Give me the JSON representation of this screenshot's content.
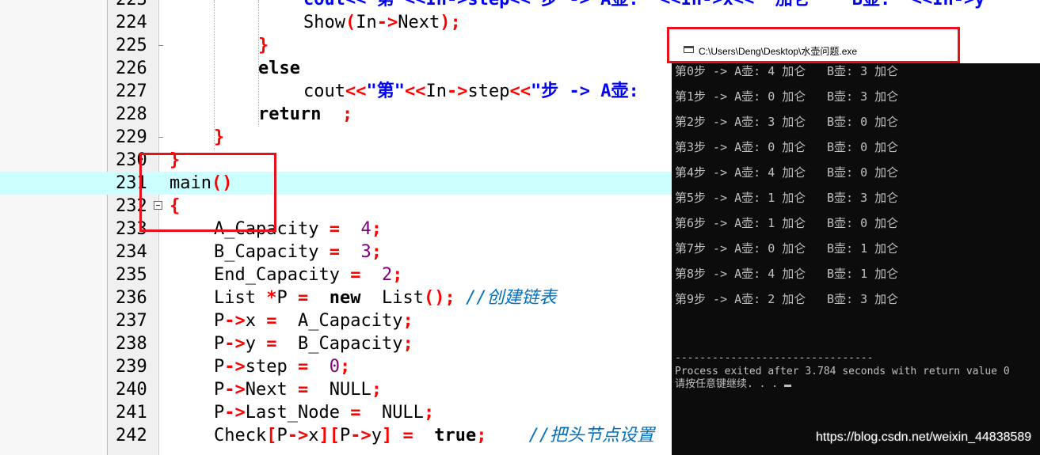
{
  "editor": {
    "lines": [
      {
        "num": "223",
        "tokens": []
      },
      {
        "num": "224",
        "tokens": [
          [
            "",
            "Show"
          ],
          [
            "pr",
            "("
          ],
          [
            "",
            "In"
          ],
          [
            "op",
            "->"
          ],
          [
            "",
            "Next"
          ],
          [
            "pr",
            ")"
          ],
          [
            "op",
            ";"
          ]
        ]
      },
      {
        "num": "225",
        "tokens": [
          [
            "pr",
            "}"
          ]
        ]
      },
      {
        "num": "226",
        "tokens": [
          [
            "kw",
            "else"
          ]
        ]
      },
      {
        "num": "227",
        "tokens": [
          [
            "",
            "cout"
          ],
          [
            "op",
            "<<"
          ],
          [
            "str",
            "\"第\""
          ],
          [
            "op",
            "<<"
          ],
          [
            "",
            "In"
          ],
          [
            "op",
            "->"
          ],
          [
            "",
            "step"
          ],
          [
            "op",
            "<<"
          ],
          [
            "str",
            "\"步 -> A壶: "
          ]
        ]
      },
      {
        "num": "228",
        "tokens": [
          [
            "kw",
            "return"
          ],
          [
            "",
            "  "
          ],
          [
            "op",
            ";"
          ]
        ]
      },
      {
        "num": "229",
        "tokens": [
          [
            "pr",
            "}"
          ]
        ]
      },
      {
        "num": "230",
        "tokens": [
          [
            "pr",
            "}"
          ]
        ]
      },
      {
        "num": "231",
        "tokens": [
          [
            "",
            "main"
          ],
          [
            "pr",
            "()"
          ]
        ]
      },
      {
        "num": "232",
        "tokens": [
          [
            "pr",
            "{"
          ]
        ]
      },
      {
        "num": "233",
        "tokens": [
          [
            "",
            "A_Capacity "
          ],
          [
            "op",
            "="
          ],
          [
            "",
            "  "
          ],
          [
            "num",
            "4"
          ],
          [
            "op",
            ";"
          ]
        ]
      },
      {
        "num": "234",
        "tokens": [
          [
            "",
            "B_Capacity "
          ],
          [
            "op",
            "="
          ],
          [
            "",
            "  "
          ],
          [
            "num",
            "3"
          ],
          [
            "op",
            ";"
          ]
        ]
      },
      {
        "num": "235",
        "tokens": [
          [
            "",
            "End_Capacity "
          ],
          [
            "op",
            "="
          ],
          [
            "",
            "  "
          ],
          [
            "num",
            "2"
          ],
          [
            "op",
            ";"
          ]
        ]
      },
      {
        "num": "236",
        "tokens": [
          [
            "",
            "List "
          ],
          [
            "op",
            "*"
          ],
          [
            "",
            "P "
          ],
          [
            "op",
            "="
          ],
          [
            "",
            "  "
          ],
          [
            "kw",
            "new"
          ],
          [
            "",
            "  List"
          ],
          [
            "pr",
            "()"
          ],
          [
            "op",
            ";"
          ],
          [
            "",
            ""
          ],
          [
            "cm",
            " //创建链表"
          ]
        ]
      },
      {
        "num": "237",
        "tokens": [
          [
            "",
            "P"
          ],
          [
            "op",
            "->"
          ],
          [
            "",
            "x "
          ],
          [
            "op",
            "="
          ],
          [
            "",
            "  A_Capacity"
          ],
          [
            "op",
            ";"
          ]
        ]
      },
      {
        "num": "238",
        "tokens": [
          [
            "",
            "P"
          ],
          [
            "op",
            "->"
          ],
          [
            "",
            "y "
          ],
          [
            "op",
            "="
          ],
          [
            "",
            "  B_Capacity"
          ],
          [
            "op",
            ";"
          ]
        ]
      },
      {
        "num": "239",
        "tokens": [
          [
            "",
            "P"
          ],
          [
            "op",
            "->"
          ],
          [
            "",
            "step "
          ],
          [
            "op",
            "="
          ],
          [
            "",
            "  "
          ],
          [
            "num",
            "0"
          ],
          [
            "op",
            ";"
          ]
        ]
      },
      {
        "num": "240",
        "tokens": [
          [
            "",
            "P"
          ],
          [
            "op",
            "->"
          ],
          [
            "",
            "Next "
          ],
          [
            "op",
            "="
          ],
          [
            "",
            "  NULL"
          ],
          [
            "op",
            ";"
          ]
        ]
      },
      {
        "num": "241",
        "tokens": [
          [
            "",
            "P"
          ],
          [
            "op",
            "->"
          ],
          [
            "",
            "Last_Node "
          ],
          [
            "op",
            "="
          ],
          [
            "",
            "  NULL"
          ],
          [
            "op",
            ";"
          ]
        ]
      },
      {
        "num": "242",
        "tokens": [
          [
            "",
            "Check"
          ],
          [
            "pr",
            "["
          ],
          [
            "",
            "P"
          ],
          [
            "op",
            "->"
          ],
          [
            "",
            "x"
          ],
          [
            "pr",
            "]["
          ],
          [
            "",
            "P"
          ],
          [
            "op",
            "->"
          ],
          [
            "",
            "y"
          ],
          [
            "pr",
            "]"
          ],
          [
            "",
            ""
          ],
          [
            "op",
            " ="
          ],
          [
            "",
            "  "
          ],
          [
            "kw",
            "true"
          ],
          [
            "op",
            ";"
          ],
          [
            "cm",
            "    //把头节点设置"
          ]
        ]
      }
    ],
    "line223_text": "cout<<\"第\"<<In->step<<\"步 -> A壶: \"<<In->x<<\" 加仑    B壶: \"<<In->y"
  },
  "console": {
    "title": "C:\\Users\\Deng\\Desktop\\水壶问题.exe",
    "rows": [
      {
        "a": "第0步 -> A壶: 4 加仑",
        "b": "B壶: 3 加仑"
      },
      {
        "a": "第1步 -> A壶: 0 加仑",
        "b": "B壶: 3 加仑"
      },
      {
        "a": "第2步 -> A壶: 3 加仑",
        "b": "B壶: 0 加仑"
      },
      {
        "a": "第3步 -> A壶: 0 加仑",
        "b": "B壶: 0 加仑"
      },
      {
        "a": "第4步 -> A壶: 4 加仑",
        "b": "B壶: 0 加仑"
      },
      {
        "a": "第5步 -> A壶: 1 加仑",
        "b": "B壶: 3 加仑"
      },
      {
        "a": "第6步 -> A壶: 1 加仑",
        "b": "B壶: 0 加仑"
      },
      {
        "a": "第7步 -> A壶: 0 加仑",
        "b": "B壶: 1 加仑"
      },
      {
        "a": "第8步 -> A壶: 4 加仑",
        "b": "B壶: 1 加仑"
      },
      {
        "a": "第9步 -> A壶: 2 加仑",
        "b": "B壶: 3 加仑"
      }
    ],
    "separator": "--------------------------------",
    "process_exit": "Process exited after 3.784 seconds with return value 0",
    "press_key": "请按任意键继续. . . "
  },
  "watermark": "https://blog.csdn.net/weixin_44838589"
}
